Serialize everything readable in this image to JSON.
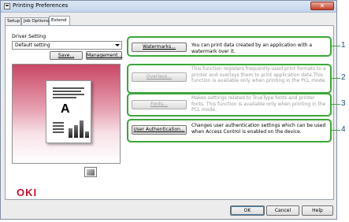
{
  "window": {
    "title": "Printing Preferences",
    "close": "✕"
  },
  "tabs": [
    "Setup",
    "Job Options",
    "Extend"
  ],
  "driver_setting": {
    "label": "Driver Setting",
    "selected": "Default setting",
    "save": "Save...",
    "management": "Management..."
  },
  "features": [
    {
      "button": "Watermarks...",
      "desc": "You can print data created by an application with a watermark over it.",
      "enabled": true,
      "number": "1"
    },
    {
      "button": "Overlays...",
      "desc": "This function registers frequently-used print formats to a printer and overlays them to print application data.This function is available only when printing in the PCL mode.",
      "enabled": false,
      "number": "2"
    },
    {
      "button": "Fonts...",
      "desc": "Makes settings related to TrueType fonts and printer fonts. This function is available only when printing in the PCL mode.",
      "enabled": false,
      "number": "3"
    },
    {
      "button": "User Authentication...",
      "desc": "Changes user authentication settings which can be used when Access Control is enabled on the device.",
      "enabled": true,
      "number": "4"
    }
  ],
  "preview": {
    "letter": "A"
  },
  "brand": "OKI",
  "footer": {
    "ok": "OK",
    "cancel": "Cancel",
    "help": "Help"
  }
}
